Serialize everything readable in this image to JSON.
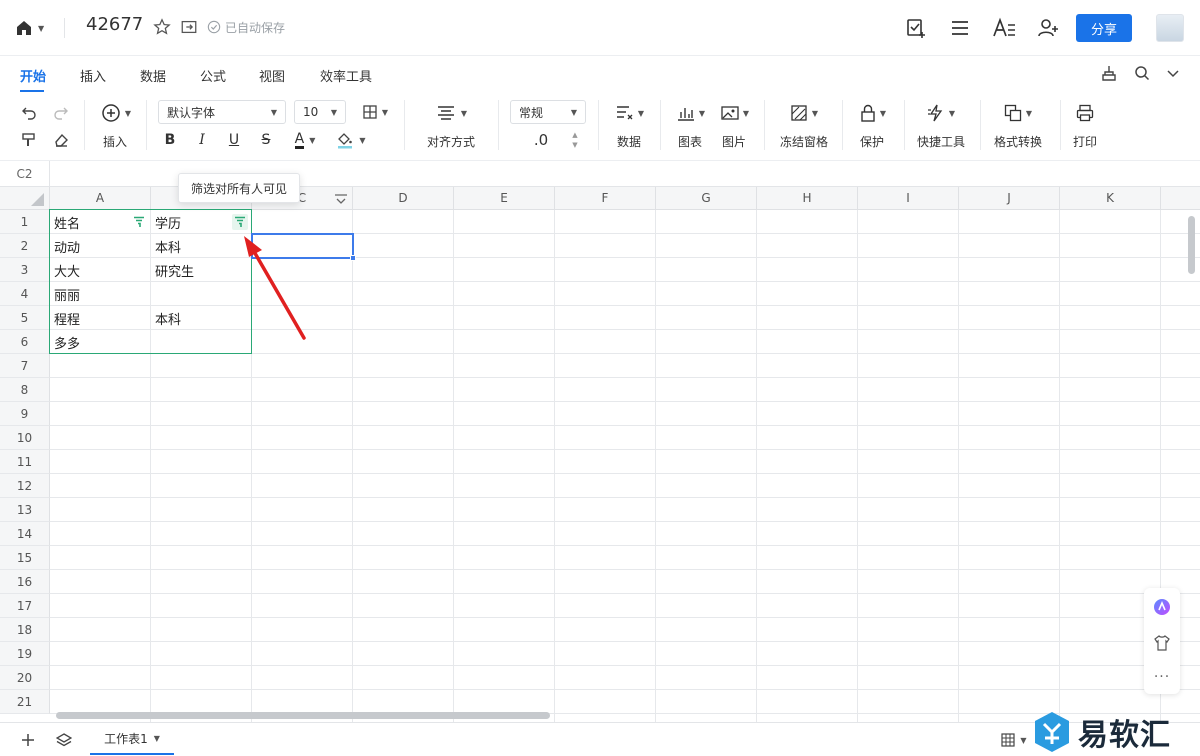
{
  "topbar": {
    "doc_title": "42677",
    "autosave": "已自动保存",
    "share_label": "分享"
  },
  "menu": {
    "tabs": [
      "开始",
      "插入",
      "数据",
      "公式",
      "视图",
      "效率工具"
    ],
    "active_index": 0
  },
  "ribbon": {
    "insert_label": "插入",
    "font_name": "默认字体",
    "font_size": "10",
    "bold": "B",
    "italic": "I",
    "underline": "U",
    "strike": "S",
    "font_color_letter": "A",
    "align_label": "对齐方式",
    "number_format": "常规",
    "decimal_label": ".0",
    "data_label": "数据",
    "chart_label": "图表",
    "picture_label": "图片",
    "freeze_label": "冻结窗格",
    "protect_label": "保护",
    "quicktools_label": "快捷工具",
    "convert_label": "格式转换",
    "print_label": "打印"
  },
  "formula_bar": {
    "cell_ref": "C2"
  },
  "grid": {
    "columns": [
      "A",
      "B",
      "C",
      "D",
      "E",
      "F",
      "G",
      "H",
      "I",
      "J",
      "K"
    ],
    "rows": [
      "1",
      "2",
      "3",
      "4",
      "5",
      "6",
      "7",
      "8",
      "9",
      "10",
      "11",
      "12",
      "13",
      "14",
      "15",
      "16",
      "17",
      "18",
      "19",
      "20",
      "21"
    ],
    "cells": {
      "A1": "姓名",
      "B1": "学历",
      "A2": "动动",
      "B2": "本科",
      "A3": "大大",
      "B3": "研究生",
      "A4": "丽丽",
      "A5": "程程",
      "B5": "本科",
      "A6": "多多"
    },
    "selected_cell": "C2"
  },
  "tooltip": {
    "text": "筛选对所有人可见"
  },
  "sheets": {
    "tabs": [
      "工作表1"
    ]
  },
  "watermark": {
    "text": "易软汇"
  },
  "colors": {
    "accent": "#1a73e8",
    "filter_green": "#2aa876",
    "arrow_red": "#e02020",
    "selection_blue": "#3d7bea"
  }
}
